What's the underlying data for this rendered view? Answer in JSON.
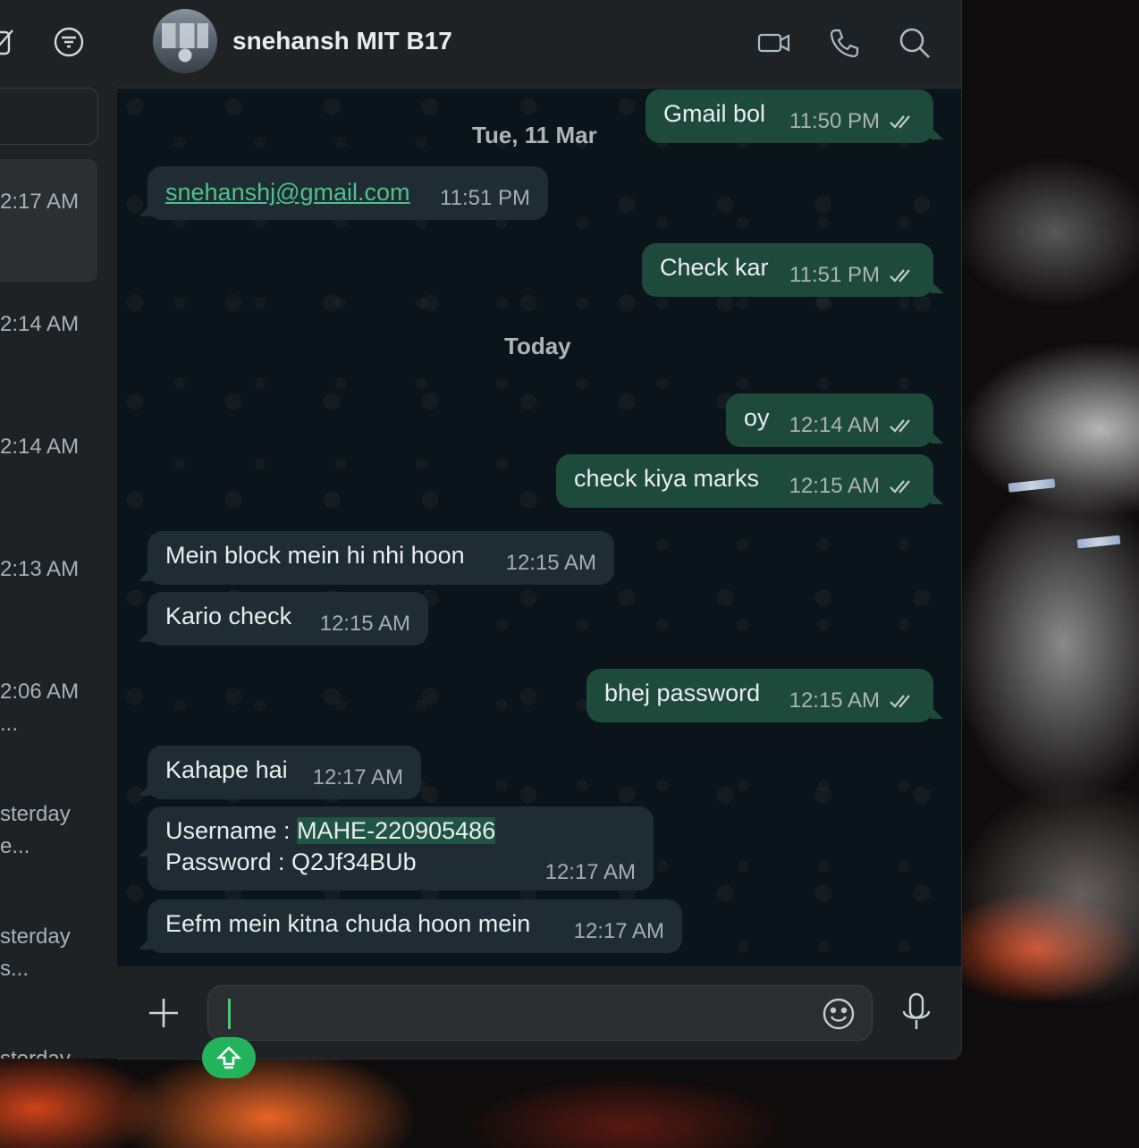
{
  "sidebar": {
    "items": [
      {
        "time": "2:17 AM",
        "preview": ""
      },
      {
        "time": "2:14 AM",
        "preview": ""
      },
      {
        "time": "2:14 AM",
        "preview": ""
      },
      {
        "time": "2:13 AM",
        "preview": ""
      },
      {
        "time": "2:06 AM",
        "preview": "..."
      },
      {
        "time": "sterday",
        "preview": "e..."
      },
      {
        "time": "sterday",
        "preview": "s..."
      },
      {
        "time": "sterday",
        "preview": ""
      }
    ]
  },
  "chat": {
    "contact_name": "snehansh MIT B17",
    "icons": {
      "video": "video-camera-icon",
      "call": "phone-icon",
      "search": "search-icon"
    }
  },
  "messages": {
    "date_tue": "Tue, 11 Mar",
    "date_today": "Today",
    "items": [
      {
        "dir": "out",
        "text": "Gmail bol",
        "time": "11:50 PM"
      },
      {
        "dir": "in",
        "text": "snehanshj@gmail.com",
        "time": "11:51 PM"
      },
      {
        "dir": "out",
        "text": "Check kar",
        "time": "11:51 PM"
      },
      {
        "dir": "out",
        "text": "oy",
        "time": "12:14 AM"
      },
      {
        "dir": "out",
        "text": "check kiya marks",
        "time": "12:15 AM"
      },
      {
        "dir": "in",
        "text": "Mein block mein hi nhi hoon",
        "time": "12:15 AM"
      },
      {
        "dir": "in",
        "text": "Kario check",
        "time": "12:15 AM"
      },
      {
        "dir": "out",
        "text": "bhej password",
        "time": "12:15 AM"
      },
      {
        "dir": "in",
        "text": "Kahape hai",
        "time": "12:17 AM"
      },
      {
        "dir": "in",
        "line1_label": "Username : ",
        "line1_value": "MAHE-220905486",
        "line2": "Password : Q2Jf34BUb",
        "time": "12:17 AM"
      },
      {
        "dir": "in",
        "text": "Eefm mein kitna chuda hoon mein",
        "time": "12:17 AM"
      }
    ]
  },
  "composer": {
    "placeholder": "",
    "icons": {
      "attach": "plus-icon",
      "emoji": "emoji-icon",
      "mic": "microphone-icon",
      "scroll": "arrow-up-icon"
    }
  },
  "colors": {
    "outgoing_bubble": "#1e4a3c",
    "incoming_bubble": "#202c33",
    "link": "#4fc08f",
    "accent": "#22b35c"
  }
}
